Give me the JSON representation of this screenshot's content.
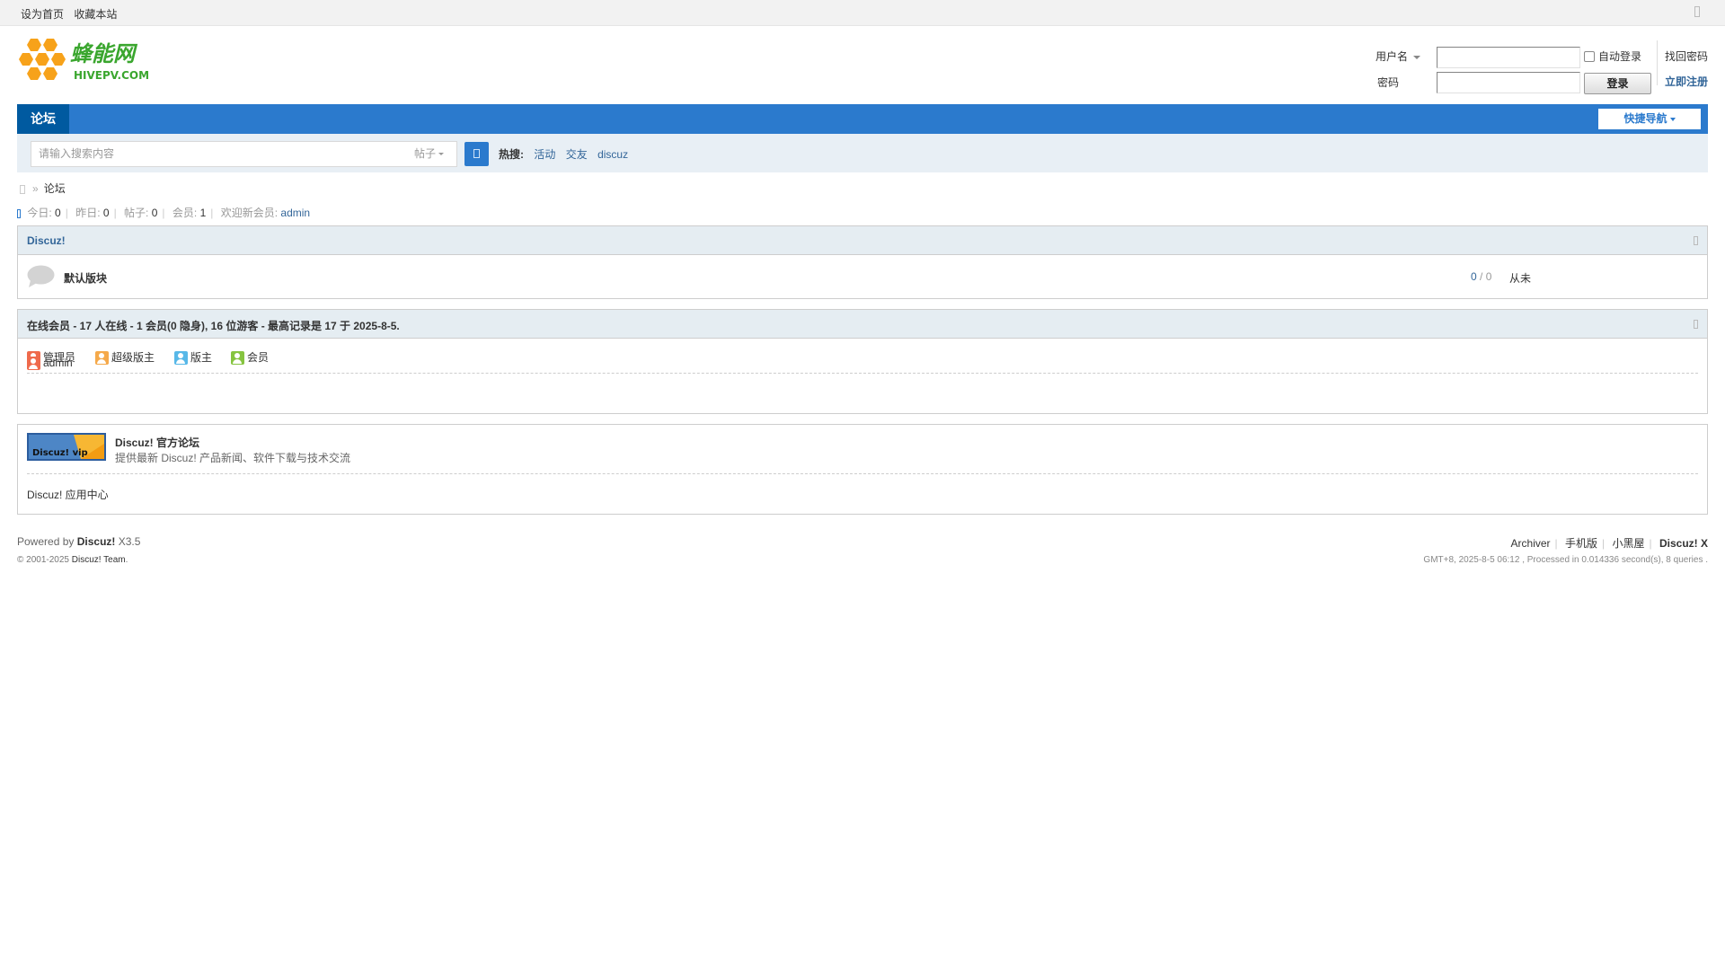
{
  "toolbar": {
    "set_home": "设为首页",
    "bookmark": "收藏本站"
  },
  "logo": {
    "name": "蜂能网",
    "domain": "HIVEPV.COM"
  },
  "login": {
    "username_label": "用户名",
    "autologin_label": "自动登录",
    "forgot_password": "找回密码",
    "password_label": "密码",
    "login_button": "登录",
    "register": "立即注册"
  },
  "nav": {
    "forum_tab": "论坛",
    "quick_nav": "快捷导航"
  },
  "search": {
    "placeholder": "请输入搜索内容",
    "type": "帖子",
    "hot_label": "热搜:",
    "hot_terms": [
      "活动",
      "交友",
      "discuz"
    ]
  },
  "breadcrumb": {
    "current": "论坛"
  },
  "stats": {
    "today_label": "今日:",
    "today": "0",
    "yesterday_label": "昨日:",
    "yesterday": "0",
    "posts_label": "帖子:",
    "posts": "0",
    "members_label": "会员:",
    "members": "1",
    "newest_label": "欢迎新会员:",
    "newest_member": "admin"
  },
  "category": {
    "title": "Discuz!",
    "forums": [
      {
        "name": "默认版块",
        "threads": "0",
        "separator": "/",
        "posts": "0",
        "last_post": "从未"
      }
    ]
  },
  "online": {
    "title": "在线会员 - 17 人在线 - 1 会员(0 隐身), 16 位游客 - 最高记录是 17 于 2025-8-5.",
    "legend": [
      "管理员",
      "超级版主",
      "版主",
      "会员"
    ],
    "users": [
      "admin"
    ]
  },
  "links": {
    "logo_text": "Discuz! vip",
    "official_name": "Discuz! 官方论坛",
    "official_desc": "提供最新 Discuz! 产品新闻、软件下载与技术交流",
    "app_center": "Discuz! 应用中心"
  },
  "footer": {
    "powered_by": "Powered by",
    "product": "Discuz!",
    "version": "X3.5",
    "copyright": "© 2001-2025",
    "team": "Discuz! Team",
    "period": ".",
    "links": [
      "Archiver",
      "手机版",
      "小黑屋",
      "Discuz! X"
    ],
    "processed": "GMT+8, 2025-8-5 06:12 , Processed in 0.014336 second(s), 8 queries ."
  },
  "colors": {
    "nav_blue": "#2b7acd",
    "nav_active": "#005aa0",
    "link_blue": "#336699",
    "logo_green": "#3aa62e",
    "logo_orange": "#f7a21a"
  }
}
